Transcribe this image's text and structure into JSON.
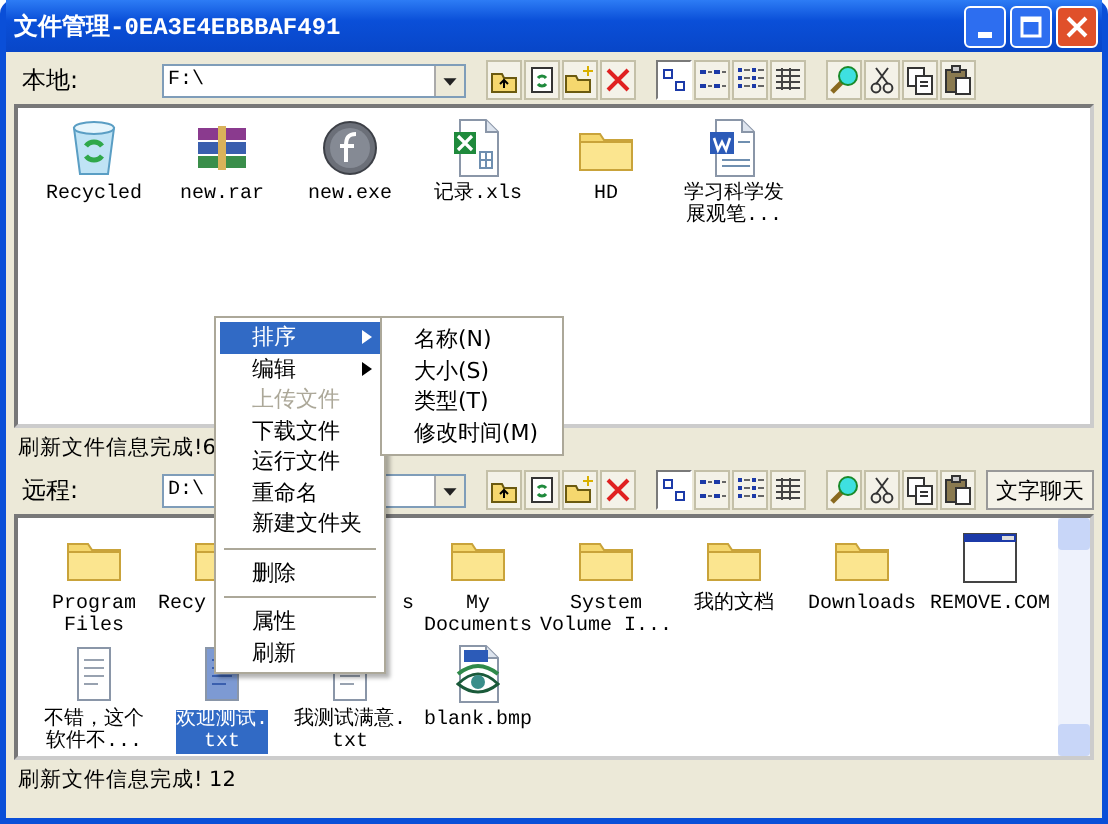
{
  "window": {
    "title": "文件管理-0EA3E4EBBBAF491"
  },
  "local": {
    "label": "本地:",
    "path": "F:\\",
    "tools": [
      {
        "kind": "up"
      },
      {
        "kind": "refresh"
      },
      {
        "kind": "newfolder"
      },
      {
        "kind": "delete"
      }
    ],
    "views": [
      {
        "kind": "large",
        "selected": true
      },
      {
        "kind": "small",
        "selected": false
      },
      {
        "kind": "list",
        "selected": false
      },
      {
        "kind": "details",
        "selected": false
      }
    ],
    "edit_tools": [
      {
        "kind": "find"
      },
      {
        "kind": "cut"
      },
      {
        "kind": "copy"
      },
      {
        "kind": "paste"
      }
    ],
    "files": [
      {
        "kind": "recycle",
        "label": [
          "Recycled"
        ],
        "selected": false
      },
      {
        "kind": "rar",
        "label": [
          "new.rar"
        ],
        "selected": false
      },
      {
        "kind": "exe",
        "label": [
          "new.exe"
        ],
        "selected": false
      },
      {
        "kind": "xls",
        "label": [
          "记录.xls"
        ],
        "selected": false
      },
      {
        "kind": "folder",
        "label": [
          "HD"
        ],
        "selected": false
      },
      {
        "kind": "doc",
        "label": [
          "学习科学发",
          "展观笔..."
        ],
        "selected": false
      }
    ],
    "status": "刷新文件信息完成!6"
  },
  "remote": {
    "label": "远程:",
    "path": "D:\\",
    "tools": [
      {
        "kind": "up"
      },
      {
        "kind": "refresh"
      },
      {
        "kind": "newfolder"
      },
      {
        "kind": "delete"
      }
    ],
    "views": [
      {
        "kind": "large",
        "selected": true
      },
      {
        "kind": "small",
        "selected": false
      },
      {
        "kind": "list",
        "selected": false
      },
      {
        "kind": "details",
        "selected": false
      }
    ],
    "edit_tools": [
      {
        "kind": "find"
      },
      {
        "kind": "cut"
      },
      {
        "kind": "copy"
      },
      {
        "kind": "paste"
      }
    ],
    "chat_button": "文字聊天",
    "files": [
      {
        "kind": "folder",
        "label": [
          "Program",
          "Files"
        ],
        "selected": false
      },
      {
        "kind": "folder",
        "label": [
          "Recy"
        ],
        "cut_at_end": true,
        "selected": false
      },
      {
        "label": [
          "s"
        ],
        "cut_at_start": true,
        "selected": false
      },
      {
        "kind": "folder",
        "label": [
          "My",
          "Documents"
        ],
        "selected": false
      },
      {
        "kind": "folder",
        "label": [
          "System",
          "Volume I..."
        ],
        "selected": false
      },
      {
        "kind": "folder",
        "label": [
          "我的文档"
        ],
        "selected": false
      },
      {
        "kind": "folder",
        "label": [
          "Downloads"
        ],
        "selected": false
      },
      {
        "kind": "app",
        "label": [
          "REMOVE.COM"
        ],
        "selected": false
      },
      {
        "kind": "txt",
        "label": [
          "不错，这个",
          "软件不..."
        ],
        "selected": false
      },
      {
        "kind": "txt",
        "label": [
          "欢迎测试.",
          "txt"
        ],
        "selected": true
      },
      {
        "kind": "txt",
        "label": [
          "我测试满意.",
          "txt"
        ],
        "selected": false
      },
      {
        "kind": "bmp",
        "label": [
          "blank.bmp"
        ],
        "selected": false
      }
    ],
    "status": "刷新文件信息完成! 12"
  },
  "context_menu": {
    "items": [
      {
        "kind": "item",
        "label": "排序",
        "arrow": true,
        "selected": true,
        "disabled": false
      },
      {
        "kind": "item",
        "label": "编辑",
        "arrow": true,
        "selected": false,
        "disabled": false
      },
      {
        "kind": "item",
        "label": "上传文件",
        "arrow": false,
        "selected": false,
        "disabled": true
      },
      {
        "kind": "item",
        "label": "下载文件",
        "arrow": false,
        "selected": false,
        "disabled": false
      },
      {
        "kind": "item",
        "label": "运行文件",
        "arrow": false,
        "selected": false,
        "disabled": false
      },
      {
        "kind": "item",
        "label": "重命名",
        "arrow": false,
        "selected": false,
        "disabled": false
      },
      {
        "kind": "item",
        "label": "新建文件夹",
        "arrow": false,
        "selected": false,
        "disabled": false
      },
      {
        "kind": "separator"
      },
      {
        "kind": "item",
        "label": "删除",
        "arrow": false,
        "selected": false,
        "disabled": false
      },
      {
        "kind": "separator"
      },
      {
        "kind": "item",
        "label": "属性",
        "arrow": false,
        "selected": false,
        "disabled": false
      },
      {
        "kind": "item",
        "label": "刷新",
        "arrow": false,
        "selected": false,
        "disabled": false
      }
    ],
    "submenu": [
      "名称(N)",
      "大小(S)",
      "类型(T)",
      "修改时间(M)"
    ]
  }
}
